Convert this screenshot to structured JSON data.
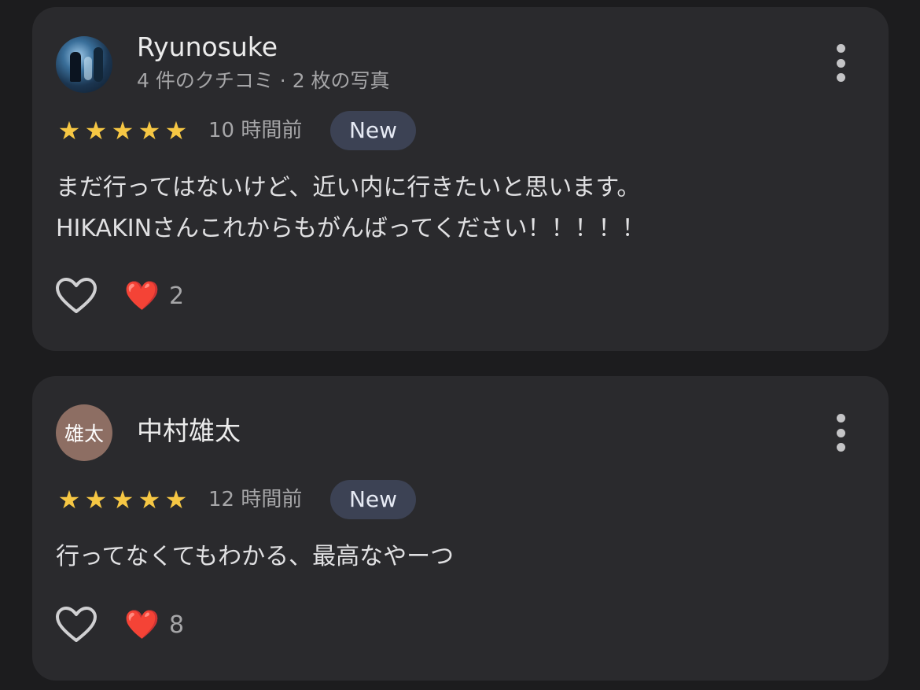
{
  "reviews": [
    {
      "author": "Ryunosuke",
      "subtitle": "4 件のクチコミ · 2 枚の写真",
      "avatar_icon": "photo",
      "rating": 5,
      "stars": "★★★★★",
      "time": "10 時間前",
      "badge": "New",
      "text_lines": [
        "まだ行ってはないけど、近い内に行きたいと思います。",
        "HIKAKINさんこれからもがんばってください！！！！！"
      ],
      "reaction_icon": "❤️",
      "reaction_count": "2"
    },
    {
      "author": "中村雄太",
      "avatar_initial": "雄太",
      "rating": 5,
      "stars": "★★★★★",
      "time": "12 時間前",
      "badge": "New",
      "text_lines": [
        "行ってなくてもわかる、最高なやーつ"
      ],
      "reaction_icon": "❤️",
      "reaction_count": "8"
    }
  ],
  "colors": {
    "background": "#1c1c1e",
    "card": "#2a2a2d",
    "star": "#f6c744",
    "badge_bg": "#3c4254",
    "heart": "#e53935"
  }
}
